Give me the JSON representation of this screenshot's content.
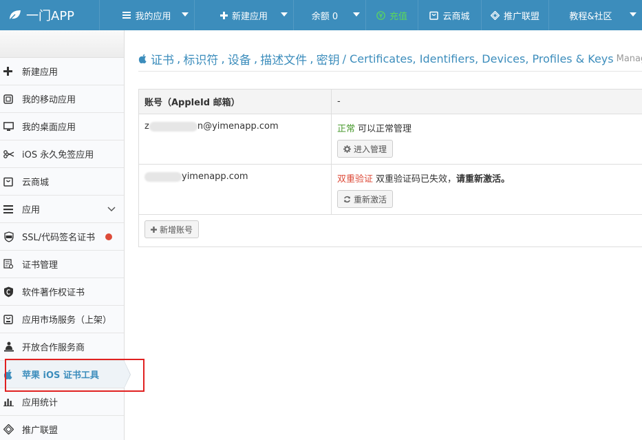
{
  "topbar": {
    "logo": "一门APP",
    "items": [
      {
        "label": "我的应用",
        "icon": "menu-icon"
      },
      {
        "label": "新建应用",
        "icon": "plus-icon"
      },
      {
        "label": "余额 0",
        "icon": ""
      },
      {
        "label": "充值",
        "icon": "yen-icon"
      },
      {
        "label": "云商城",
        "icon": "store-icon"
      },
      {
        "label": "推广联盟",
        "icon": "diamond-icon"
      },
      {
        "label": "教程&社区",
        "icon": ""
      }
    ]
  },
  "sidebar": {
    "items": [
      {
        "label": "新建应用",
        "icon": "plus-icon"
      },
      {
        "label": "我的移动应用",
        "icon": "tablet-icon"
      },
      {
        "label": "我的桌面应用",
        "icon": "desktop-icon"
      },
      {
        "label": "iOS 永久免签应用",
        "icon": "scissors-icon"
      },
      {
        "label": "云商城",
        "icon": "store-icon"
      },
      {
        "label": "应用",
        "icon": "list-icon"
      },
      {
        "label": "SSL/代码签名证书",
        "icon": "ssl-icon"
      },
      {
        "label": "证书管理",
        "icon": "certificate-icon"
      },
      {
        "label": "软件著作权证书",
        "icon": "copyright-shield-icon"
      },
      {
        "label": "应用市场服务（上架）",
        "icon": "market-icon"
      },
      {
        "label": "开放合作服务商",
        "icon": "partner-icon"
      },
      {
        "label": "苹果 iOS 证书工具",
        "icon": "apple-icon"
      },
      {
        "label": "应用统计",
        "icon": "bar-chart-icon"
      },
      {
        "label": "推广联盟",
        "icon": "diamond-icon"
      }
    ]
  },
  "page": {
    "title_parts": [
      "证书",
      "标识符",
      "设备",
      "描述文件",
      "密钥"
    ],
    "title_en": "/ Certificates, Identifiers, Devices, Profiles & Keys",
    "title_small": "Manage"
  },
  "table": {
    "header_account": "账号（AppleId 邮箱）",
    "header_status": "-",
    "rows": [
      {
        "email_prefix": "z",
        "email_suffix": "n@yimenapp.com",
        "status_tag": "正常",
        "status_text": "可以正常管理",
        "button": "进入管理"
      },
      {
        "email_prefix": "",
        "email_suffix": "yimenapp.com",
        "status_tag": "双重验证",
        "status_text": "双重验证码已失效，",
        "status_bold": "请重新激活。",
        "button": "重新激活"
      }
    ],
    "add_button": "新增账号"
  },
  "colors": {
    "brand": "#3c8dbc",
    "ok": "#4a9a2f",
    "error": "#dd4b39",
    "highlight": "#e02020"
  }
}
